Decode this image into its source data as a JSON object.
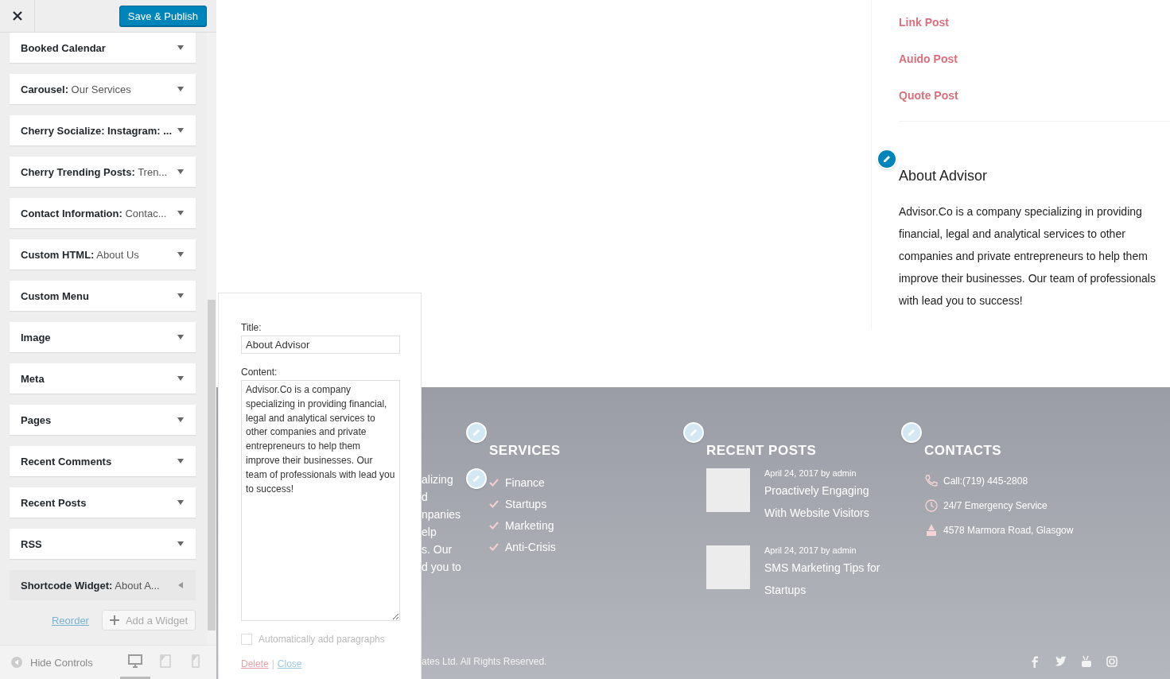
{
  "customizer": {
    "save_button": "Save & Publish"
  },
  "widgets": [
    {
      "name": "Booked Calendar",
      "expanded": false
    },
    {
      "name": "Carousel:",
      "title": "Our Services",
      "expanded": false
    },
    {
      "name": "Cherry Socialize: Instagram: ...",
      "expanded": false
    },
    {
      "name": "Cherry Trending Posts:",
      "title": "Tren...",
      "expanded": false
    },
    {
      "name": "Contact Information:",
      "title": "Contac...",
      "expanded": false
    },
    {
      "name": "Custom HTML:",
      "title": "About Us",
      "expanded": false
    },
    {
      "name": "Custom Menu",
      "expanded": false
    },
    {
      "name": "Image",
      "expanded": false
    },
    {
      "name": "Meta",
      "expanded": false
    },
    {
      "name": "Pages",
      "expanded": false
    },
    {
      "name": "Recent Comments",
      "expanded": false
    },
    {
      "name": "Recent Posts",
      "expanded": false
    },
    {
      "name": "RSS",
      "expanded": false
    },
    {
      "name": "Shortcode Widget:",
      "title": "About A...",
      "expanded": true
    }
  ],
  "reorder_link": "Reorder",
  "add_widget_button": "Add a Widget",
  "bottom_bar": {
    "hide_controls": "Hide Controls",
    "devices": [
      {
        "kind": "desktop",
        "selected": true
      },
      {
        "kind": "tablet",
        "selected": false
      },
      {
        "kind": "mobile",
        "selected": false
      }
    ]
  },
  "widget_form": {
    "title_label": "Title:",
    "title_value": "About Advisor",
    "content_label": "Content:",
    "content_value": "Advisor.Co is a company specializing in providing financial, legal and analytical services to other companies and private entrepreneurs to help them improve their businesses. Our team of professionals with lead you to success!",
    "auto_paragraphs": {
      "label": "Automatically add paragraphs",
      "checked": false
    },
    "delete_link": "Delete",
    "separator": "|",
    "close_link": "Close"
  },
  "preview": {
    "sidebar": {
      "links": [
        "Link Post",
        "Auido Post",
        "Quote Post"
      ],
      "about_title": "About Advisor",
      "about_text": "Advisor.Co is a company specializing in providing financial, legal and analytical services to other companies and private entrepreneurs to help them improve their businesses. Our team of professionals with lead you to success!"
    },
    "footer": {
      "about_fragments": [
        "alizing",
        "d",
        "npanies",
        "elp",
        "s. Our",
        "d you to"
      ],
      "services": {
        "heading": "SERVICES",
        "items": [
          "Finance",
          "Startups",
          "Marketing",
          "Anti-Crisis"
        ]
      },
      "recent_posts": {
        "heading": "RECENT POSTS",
        "posts": [
          {
            "meta": "April 24, 2017 by admin",
            "title": "Proactively Engaging With Website Visitors"
          },
          {
            "meta": "April 24, 2017 by admin",
            "title": "SMS Marketing Tips for Startups"
          }
        ]
      },
      "contacts": {
        "heading": "CONTACTS",
        "items": [
          {
            "kind": "phone",
            "text": "Call:(719) 445-2808"
          },
          {
            "kind": "clock",
            "text": "24/7 Emergency Service"
          },
          {
            "kind": "location",
            "text": "4578 Marmora Road, Glasgow"
          }
        ]
      },
      "copyright": "ates Ltd. All Rights Reserved."
    }
  }
}
